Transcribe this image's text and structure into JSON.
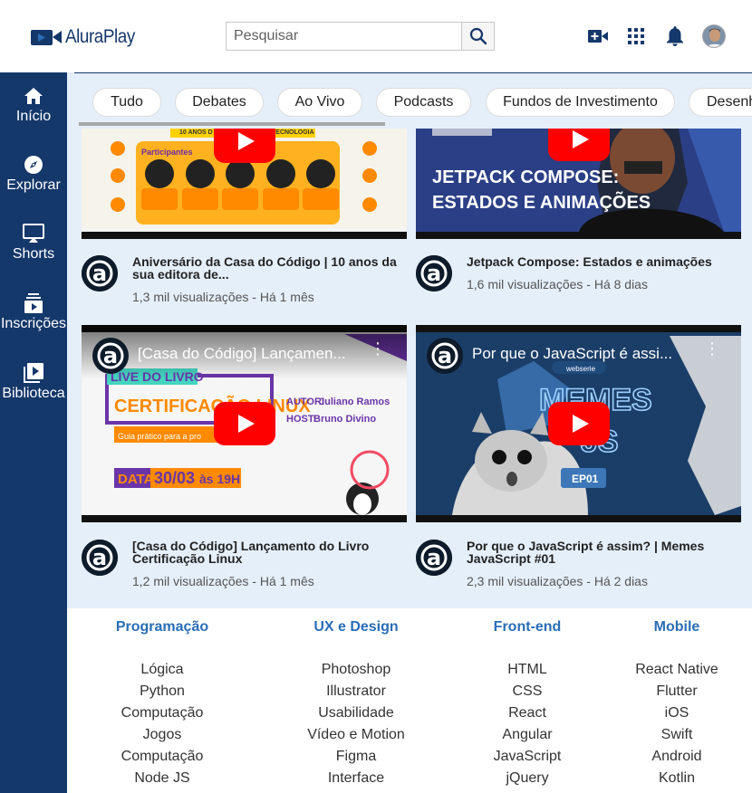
{
  "header": {
    "brand": "AluraPlay",
    "search_placeholder": "Pesquisar",
    "icons": [
      "create-video-icon",
      "apps-grid-icon",
      "notifications-icon",
      "user-avatar"
    ]
  },
  "sidebar": {
    "items": [
      {
        "label": "Início",
        "icon": "home-icon"
      },
      {
        "label": "Explorar",
        "icon": "compass-icon"
      },
      {
        "label": "Shorts",
        "icon": "shorts-icon"
      },
      {
        "label": "Inscrições",
        "icon": "subscriptions-icon"
      },
      {
        "label": "Biblioteca",
        "icon": "library-icon"
      }
    ]
  },
  "chips": [
    "Tudo",
    "Debates",
    "Ao Vivo",
    "Podcasts",
    "Fundos de Investimento",
    "Desenh"
  ],
  "videos": [
    {
      "title": "Aniversário da Casa do Código | 10 anos da sua editora de...",
      "views": "1,3 mil visualizações - Há 1 mês",
      "thumb_header": "10 ANOS D",
      "thumb_header2": "TECNOLOGIA",
      "thumb_label": "Participantes"
    },
    {
      "title": "Jetpack Compose: Estados e animações",
      "views": "1,6 mil visualizações - Há 8 dias",
      "thumb_line1": "JETPACK COMPOSE:",
      "thumb_line2": "ESTADOS E ANIMAÇÕES"
    },
    {
      "title": "[Casa do Código] Lançamento do Livro Certificação Linux",
      "views": "1,2 mil visualizações - Há 1 mês",
      "embed_title": "[Casa do Código] Lançamen...",
      "live": "LIVE DO LIVRO",
      "book": "CERTIFICAÇÃO LINUX",
      "guide": "Guia prático para a pro",
      "author_label": "AUTOR:",
      "author": "Juliano Ramos",
      "host_label": "HOST:",
      "host": "Bruno Divino",
      "date_label": "DATA",
      "date": "30/03",
      "time": "às 19H"
    },
    {
      "title": "Por que o JavaScript é assim? | Memes JavaScript #01",
      "views": "2,3 mil visualizações - Há 2 dias",
      "embed_title": "Por que o JavaScript é assi...",
      "webserie": "webserie",
      "memes": "MEMES",
      "js": "JS",
      "ep": "EP01"
    }
  ],
  "footer": {
    "columns": [
      {
        "title": "Programação",
        "links": [
          "Lógica",
          "Python",
          "Computação",
          "Jogos",
          "Computação",
          "Node JS"
        ]
      },
      {
        "title": "UX e Design",
        "links": [
          "Photoshop",
          "Illustrator",
          "Usabilidade",
          "Vídeo e Motion",
          "Figma",
          "Interface"
        ]
      },
      {
        "title": "Front-end",
        "links": [
          "HTML",
          "CSS",
          "React",
          "Angular",
          "JavaScript",
          "jQuery"
        ]
      },
      {
        "title": "Mobile",
        "links": [
          "React Native",
          "Flutter",
          "iOS",
          "Swift",
          "Android",
          "Kotlin"
        ]
      }
    ]
  },
  "colors": {
    "brand": "#15386a",
    "content_bg": "#e5effa",
    "accent_blue": "#2a6db5",
    "youtube_red": "#ff0000"
  }
}
